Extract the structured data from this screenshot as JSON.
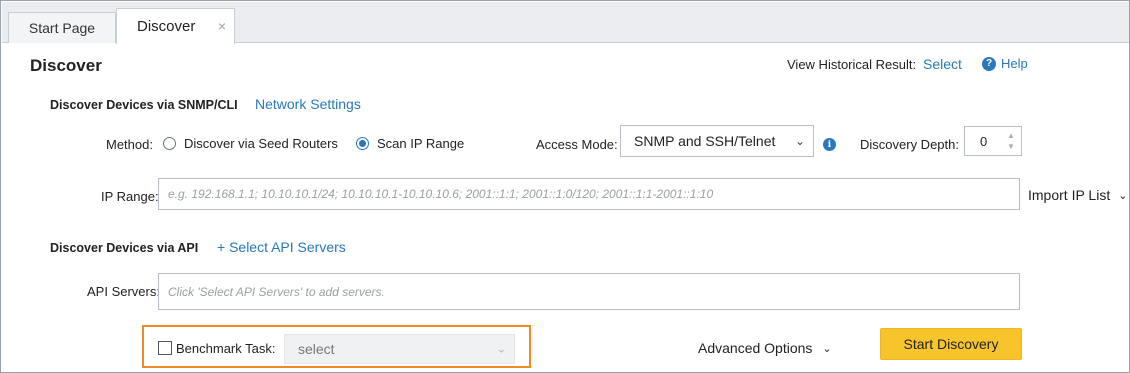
{
  "tabs": [
    {
      "label": "Start Page",
      "active": false
    },
    {
      "label": "Discover",
      "active": true,
      "close_icon": "×"
    }
  ],
  "page": {
    "title": "Discover",
    "view_historical_label": "View Historical Result:",
    "view_historical_link": "Select",
    "help_icon": "?",
    "help_label": "Help"
  },
  "snmp_section": {
    "title": "Discover Devices via SNMP/CLI",
    "network_settings_link": "Network Settings",
    "method_label": "Method:",
    "method_options": [
      {
        "label": "Discover via Seed Routers",
        "selected": false
      },
      {
        "label": "Scan IP Range",
        "selected": true
      }
    ],
    "access_mode_label": "Access Mode:",
    "access_mode_value": "SNMP and SSH/Telnet",
    "info_icon": "i",
    "discovery_depth_label": "Discovery Depth:",
    "discovery_depth_value": "0",
    "ip_range_label": "IP Range:",
    "ip_range_placeholder": "e.g. 192.168.1.1; 10.10.10.1/24; 10.10.10.1-10.10.10.6; 2001::1:1; 2001::1:0/120; 2001::1:1-2001::1:10",
    "import_ip_list_label": "Import IP List"
  },
  "api_section": {
    "title": "Discover Devices via API",
    "select_api_link": "+ Select API Servers",
    "api_servers_label": "API Servers:",
    "api_servers_placeholder": "Click 'Select API Servers' to add servers."
  },
  "footer": {
    "benchmark_label": "Benchmark Task:",
    "benchmark_checked": false,
    "benchmark_select_value": "select",
    "advanced_options_label": "Advanced Options",
    "start_discovery_label": "Start Discovery"
  },
  "colors": {
    "accent": "#2a78b9",
    "start_button": "#f7c42c",
    "highlight_border": "#f08a24"
  }
}
